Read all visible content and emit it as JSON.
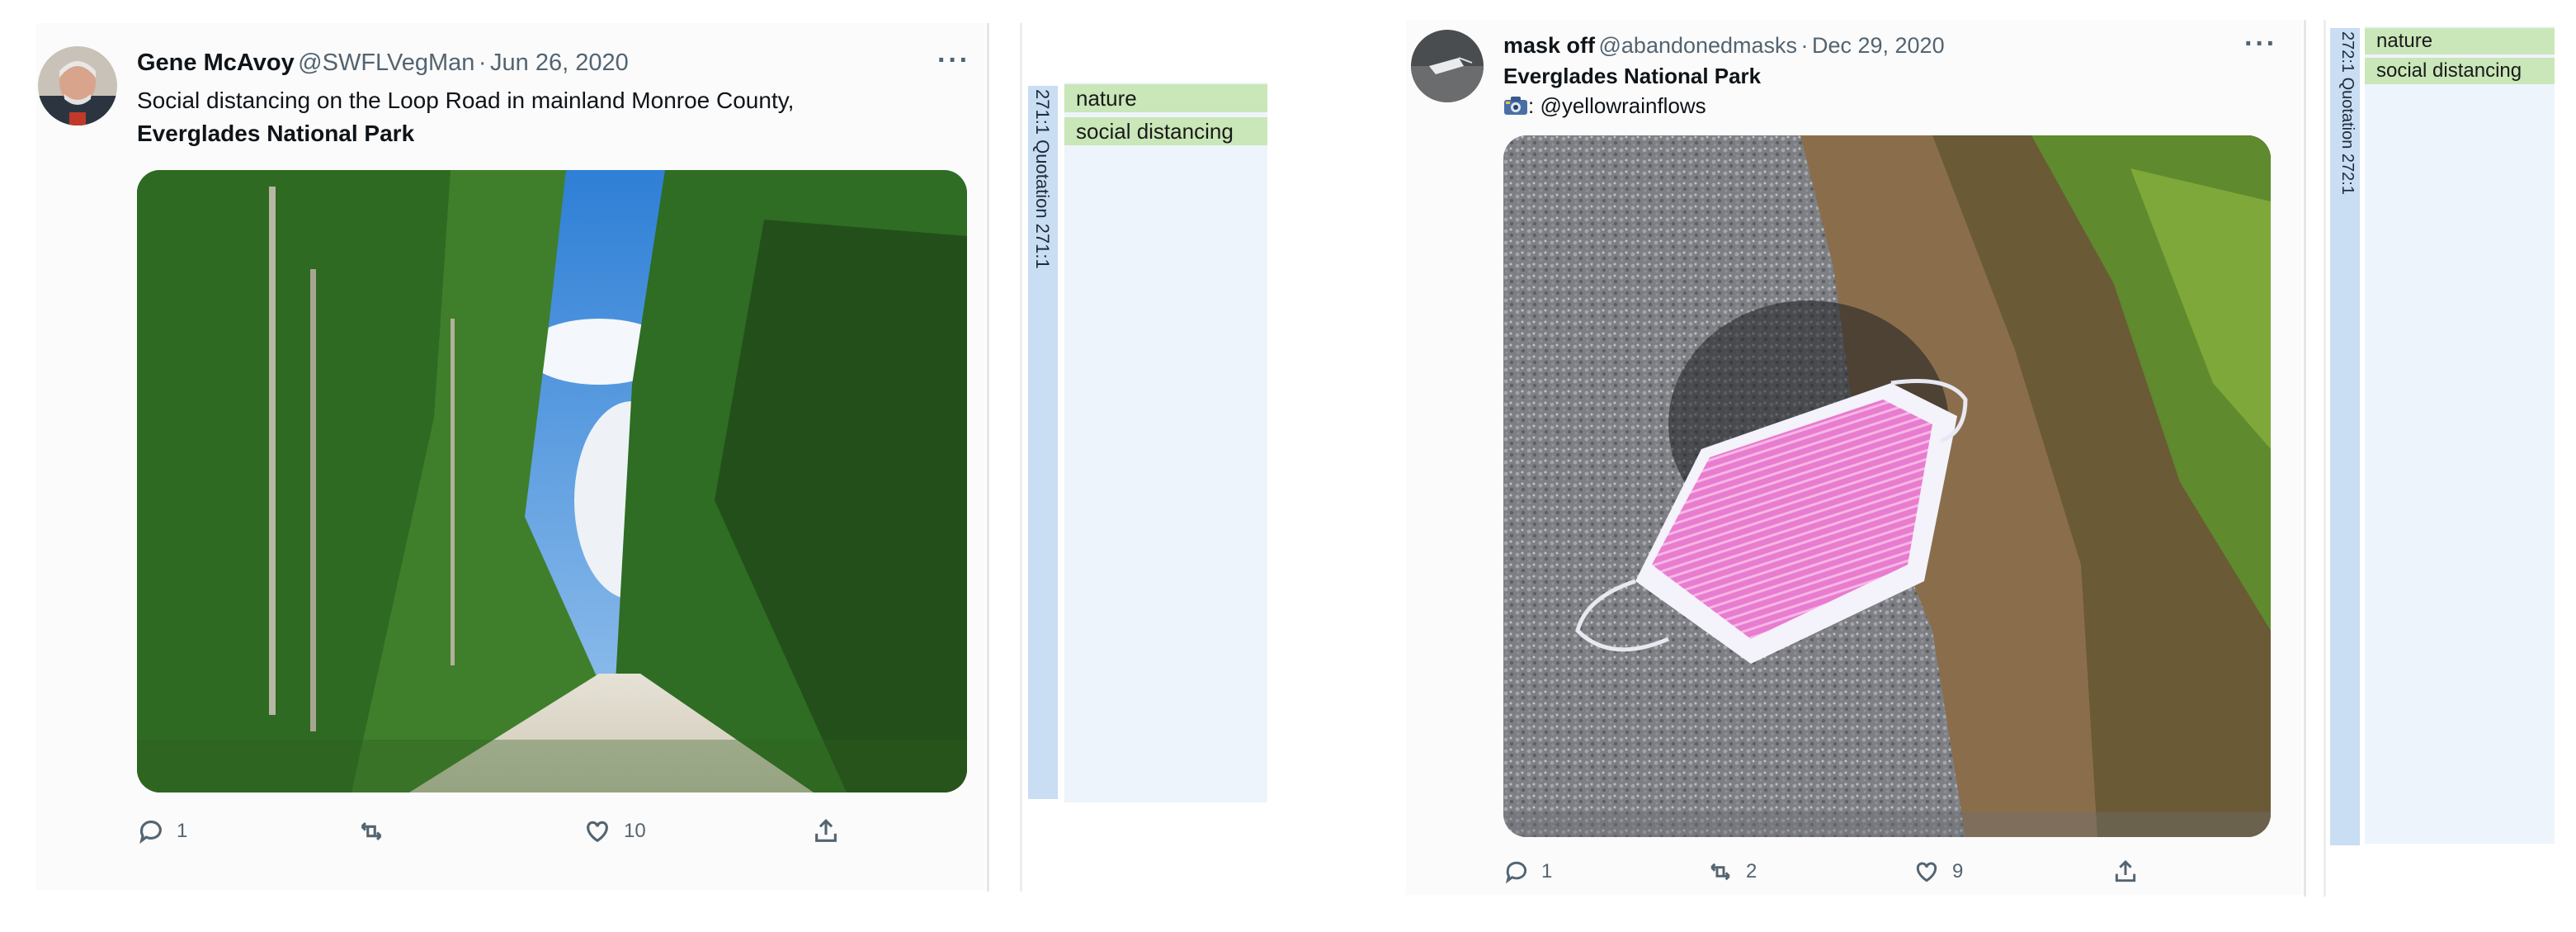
{
  "tweets": [
    {
      "name": "Gene McAvoy",
      "handle": "@SWFLVegMan",
      "sep": "·",
      "date": "Jun 26, 2020",
      "text": "Social distancing on the Loop Road in mainland Monroe County,",
      "text_bold": "Everglades National Park",
      "more": "···",
      "replies": "1",
      "retweets": "",
      "likes": "10",
      "quotation": "271:1 Quotation 271:1",
      "codes": [
        "nature",
        "social distancing"
      ]
    },
    {
      "name": "mask off",
      "handle": "@abandonedmasks",
      "sep": "·",
      "date": "Dec 29, 2020",
      "text_bold": "Everglades National Park",
      "credit": ": @yellowrainflows",
      "more": "···",
      "replies": "1",
      "retweets": "2",
      "likes": "9",
      "quotation": "272:1 Quotation 272:1",
      "codes": [
        "nature",
        "social distancing"
      ]
    }
  ],
  "icons": {
    "reply": "reply-icon",
    "retweet": "retweet-icon",
    "like": "heart-icon",
    "share": "share-icon",
    "camera": "camera-icon"
  },
  "colors": {
    "code_bg": "#c9e7b8",
    "quotation_bar": "#c9ddf3",
    "muted_text": "#536471"
  }
}
